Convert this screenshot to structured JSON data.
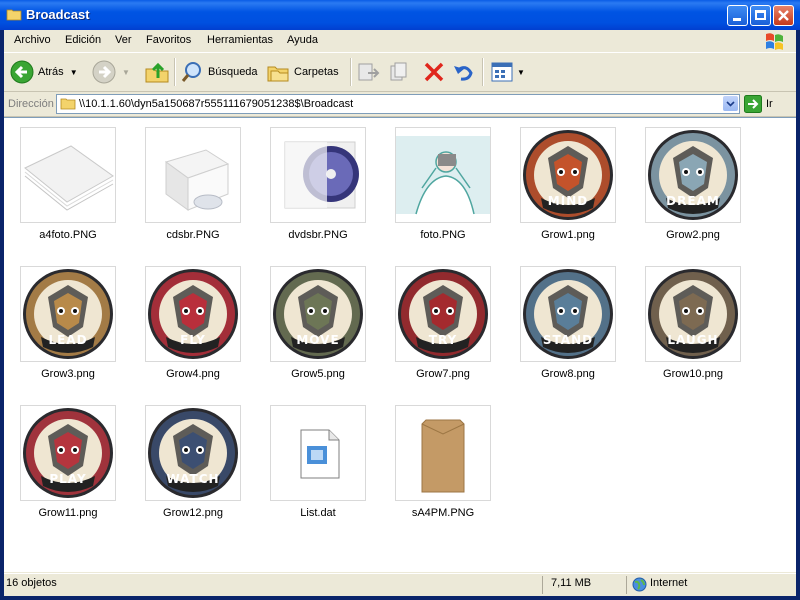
{
  "window": {
    "title": "Broadcast"
  },
  "menu": [
    "Archivo",
    "Edición",
    "Ver",
    "Favoritos",
    "Herramientas",
    "Ayuda"
  ],
  "toolbar": {
    "back": "Atrás",
    "search": "Búsqueda",
    "folders": "Carpetas"
  },
  "address": {
    "label": "Dirección",
    "value": "\\\\10.1.1.60\\dyn5a150687r555111679051238$\\Broadcast",
    "go": "Ir"
  },
  "files": [
    {
      "name": "a4foto.PNG",
      "kind": "paper",
      "badge": ""
    },
    {
      "name": "cdsbr.PNG",
      "kind": "cdbox",
      "badge": ""
    },
    {
      "name": "dvdsbr.PNG",
      "kind": "dvd",
      "badge": ""
    },
    {
      "name": "foto.PNG",
      "kind": "photo",
      "badge": ""
    },
    {
      "name": "Grow1.png",
      "kind": "emblem",
      "badge": "MIND",
      "color": "#c4532b"
    },
    {
      "name": "Grow2.png",
      "kind": "emblem",
      "badge": "DREAM",
      "color": "#8aa6b4"
    },
    {
      "name": "Grow3.png",
      "kind": "emblem",
      "badge": "LEAD",
      "color": "#b88a4a"
    },
    {
      "name": "Grow4.png",
      "kind": "emblem",
      "badge": "FLY",
      "color": "#b92f3b"
    },
    {
      "name": "Grow5.png",
      "kind": "emblem",
      "badge": "MOVE",
      "color": "#6d7656"
    },
    {
      "name": "Grow7.png",
      "kind": "emblem",
      "badge": "TRY",
      "color": "#a42a2e"
    },
    {
      "name": "Grow8.png",
      "kind": "emblem",
      "badge": "STAND",
      "color": "#5a7e99"
    },
    {
      "name": "Grow10.png",
      "kind": "emblem",
      "badge": "LAUGH",
      "color": "#7d6a52"
    },
    {
      "name": "Grow11.png",
      "kind": "emblem",
      "badge": "PLAY",
      "color": "#b5353e"
    },
    {
      "name": "Grow12.png",
      "kind": "emblem",
      "badge": "WATCH",
      "color": "#3c4f72"
    },
    {
      "name": "List.dat",
      "kind": "doc",
      "badge": ""
    },
    {
      "name": "sA4PM.PNG",
      "kind": "envelope",
      "badge": ""
    }
  ],
  "status": {
    "count": "16 objetos",
    "size": "7,11 MB",
    "zone": "Internet"
  }
}
